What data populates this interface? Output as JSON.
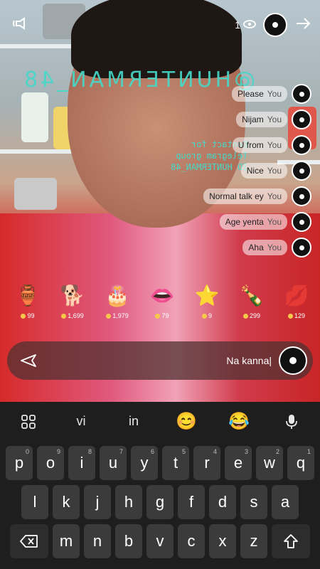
{
  "header": {
    "viewer_count": "1"
  },
  "watermark": {
    "text": "@HUNTERMAN_48",
    "contact_lines": [
      "Contact for",
      "Telegram group",
      "ID HUNTERMAN_48"
    ]
  },
  "chat": [
    {
      "who": "You",
      "text": "Please"
    },
    {
      "who": "You",
      "text": "Nijam"
    },
    {
      "who": "You",
      "text": "U from"
    },
    {
      "who": "You",
      "text": "Nice"
    },
    {
      "who": "You",
      "text": "Normal talk ey"
    },
    {
      "who": "You",
      "text": "Age yenta"
    },
    {
      "who": "You",
      "text": "Aha"
    }
  ],
  "gifts": [
    {
      "emoji": "💋",
      "price": "129"
    },
    {
      "emoji": "🍾",
      "price": "299"
    },
    {
      "emoji": "⭐",
      "price": "9"
    },
    {
      "emoji": "👄",
      "price": "79"
    },
    {
      "emoji": "🎂",
      "price": "1,979"
    },
    {
      "emoji": "🐕",
      "price": "1,699"
    },
    {
      "emoji": "🏺",
      "price": "99"
    }
  ],
  "input": {
    "text": "Na kanna|"
  },
  "keyboard": {
    "suggestions": [
      "vi",
      "in"
    ],
    "row1": [
      [
        "q",
        "1"
      ],
      [
        "w",
        "2"
      ],
      [
        "e",
        "3"
      ],
      [
        "r",
        "4"
      ],
      [
        "t",
        "5"
      ],
      [
        "y",
        "6"
      ],
      [
        "u",
        "7"
      ],
      [
        "i",
        "8"
      ],
      [
        "o",
        "9"
      ],
      [
        "p",
        "0"
      ]
    ],
    "row2": [
      "a",
      "s",
      "d",
      "f",
      "g",
      "h",
      "j",
      "k",
      "l"
    ],
    "row3": [
      "z",
      "x",
      "c",
      "v",
      "b",
      "n",
      "m"
    ]
  }
}
